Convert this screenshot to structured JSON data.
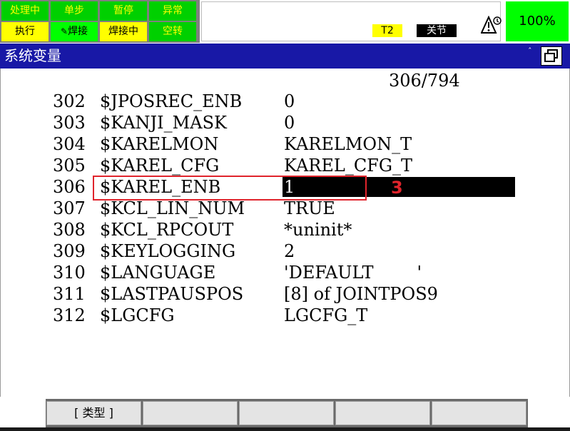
{
  "status_panel": {
    "cells": [
      {
        "label": "处理中",
        "bg": "#00d000",
        "fg": "#ffff00"
      },
      {
        "label": "单步",
        "bg": "#00d000",
        "fg": "#ffff00"
      },
      {
        "label": "暂停",
        "bg": "#00d000",
        "fg": "#ffff00"
      },
      {
        "label": "异常",
        "bg": "#00d000",
        "fg": "#ffff00"
      },
      {
        "label": "执行",
        "bg": "#ffff00",
        "fg": "#000000"
      },
      {
        "label": "焊接",
        "bg": "#00ff00",
        "fg": "#000000"
      },
      {
        "label": "焊接中",
        "bg": "#ffff00",
        "fg": "#000000"
      },
      {
        "label": "空转",
        "bg": "#00d000",
        "fg": "#ffff00"
      }
    ],
    "t2_label": "T2",
    "joint_label": "关节",
    "alarm_icon": "warning-triangle-icon",
    "override": "100%"
  },
  "title_bar": {
    "title": "系统变量",
    "window_icon": "restore-window-icon"
  },
  "counter": "306/794",
  "rows": [
    {
      "num": "302",
      "name": "$JPOSREC_ENB",
      "value": "0"
    },
    {
      "num": "303",
      "name": "$KANJI_MASK",
      "value": "0"
    },
    {
      "num": "304",
      "name": "$KARELMON",
      "value": "KARELMON_T"
    },
    {
      "num": "305",
      "name": "$KAREL_CFG",
      "value": "KAREL_CFG_T"
    },
    {
      "num": "306",
      "name": "$KAREL_ENB",
      "value": "1"
    },
    {
      "num": "307",
      "name": "$KCL_LIN_NUM",
      "value": "TRUE"
    },
    {
      "num": "308",
      "name": "$KCL_RPCOUT",
      "value": "*uninit*"
    },
    {
      "num": "309",
      "name": "$KEYLOGGING",
      "value": "2"
    },
    {
      "num": "310",
      "name": "$LANGUAGE",
      "value": "'DEFAULT        '"
    },
    {
      "num": "311",
      "name": "$LASTPAUSPOS",
      "value": "[8] of JOINTPOS9"
    },
    {
      "num": "312",
      "name": "$LGCFG",
      "value": "LGCFG_T"
    }
  ],
  "annotation": "3",
  "fkeys": [
    "[ 类型 ]",
    "",
    "",
    "",
    ""
  ],
  "colors": {
    "title_bg": "#1818a6",
    "highlight": "#e0242c"
  }
}
